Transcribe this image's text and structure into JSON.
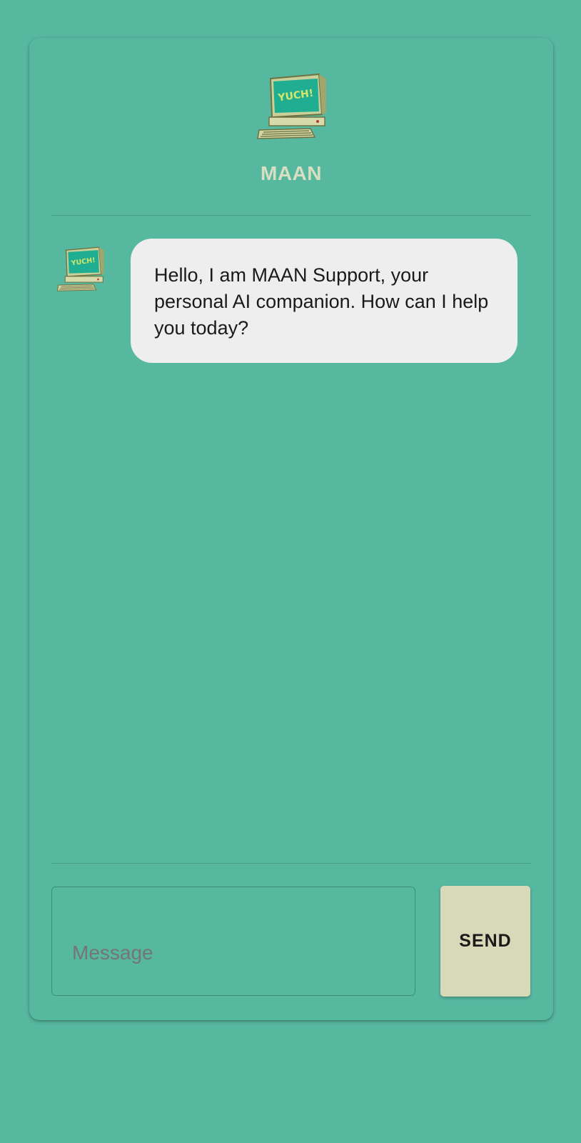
{
  "header": {
    "title": "MAAN",
    "logo_icon": "retro-computer-icon",
    "logo_screen_text": "YUCH!"
  },
  "chat": {
    "messages": [
      {
        "sender": "bot",
        "avatar_icon": "retro-computer-icon",
        "text": "Hello, I am MAAN Support, your personal AI companion. How can I help you today?"
      }
    ]
  },
  "composer": {
    "placeholder": "Message",
    "send_label": "SEND"
  },
  "colors": {
    "background": "#57b8a0",
    "title": "#d8dfc0",
    "bubble": "#eeeeee",
    "send_button": "#d8d9b9",
    "screen": "#1fae91"
  }
}
